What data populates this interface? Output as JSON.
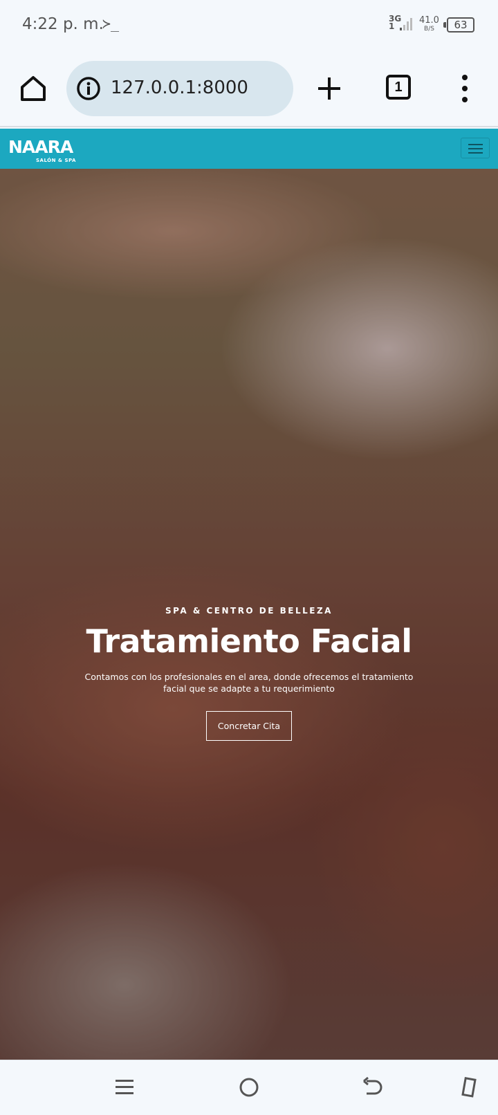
{
  "status_bar": {
    "time": "4:22 p. m.",
    "terminal_glyph": "≻_",
    "network_type": "3G",
    "network_sub": "1",
    "speed_value": "41.0",
    "speed_unit": "B/S",
    "battery": "63"
  },
  "browser": {
    "url": "127.0.0.1:8000",
    "tab_count": "1"
  },
  "site_nav": {
    "brand": "NAARA",
    "brand_sub": "SALÓN & SPA"
  },
  "hero": {
    "kicker": "SPA & CENTRO DE BELLEZA",
    "title": "Tratamiento Facial",
    "description": "Contamos con los profesionales en el area, donde ofrecemos el tratamiento facial que se adapte a tu requerimiento",
    "button_label": "Concretar Cita"
  },
  "icons": {
    "home": "home-icon",
    "info": "info-icon",
    "new_tab": "plus-icon",
    "menu": "more-vert-icon",
    "nav_toggle": "hamburger-icon",
    "recents": "recents-icon",
    "home_nav": "home-circle-icon",
    "back": "back-icon",
    "rotate": "rotate-icon"
  },
  "colors": {
    "navbar": "#1ca8c0",
    "browser_bg": "#f4f8fc",
    "url_pill": "#d8e6ee"
  }
}
